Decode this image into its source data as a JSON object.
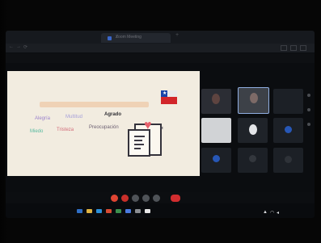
{
  "browser": {
    "tab_title": "Zoom Meeting",
    "tab_close": "×",
    "new_tab": "+",
    "address": "",
    "back_glyph": "←",
    "forward_glyph": "→",
    "reload_glyph": "⟳"
  },
  "zoom": {
    "meeting_title": "",
    "left_status": ""
  },
  "slide": {
    "heading": "",
    "flag_star": "★",
    "info_glyph": "i",
    "words": [
      {
        "name": "word-agrado",
        "text": "Agrado"
      },
      {
        "name": "word-alegria",
        "text": "Alegría"
      },
      {
        "name": "word-multitud",
        "text": "Multitud"
      },
      {
        "name": "word-miedo",
        "text": "Miedo"
      },
      {
        "name": "word-tristeza",
        "text": "Tristeza"
      },
      {
        "name": "word-preocupacion",
        "text": "Preocupación"
      },
      {
        "name": "word-extra-1",
        "text": ""
      },
      {
        "name": "word-extra-2",
        "text": ""
      },
      {
        "name": "word-extra-3",
        "text": ""
      },
      {
        "name": "word-extra-4",
        "text": ""
      },
      {
        "name": "word-extra-5",
        "text": ""
      },
      {
        "name": "word-extra-6",
        "text": ""
      }
    ]
  },
  "participants": [
    {
      "label": ""
    },
    {
      "label": ""
    },
    {
      "label": ""
    },
    {
      "label": ""
    },
    {
      "label": ""
    },
    {
      "label": ""
    },
    {
      "label": ""
    },
    {
      "label": ""
    },
    {
      "label": ""
    },
    {
      "label": ""
    },
    {
      "label": ""
    },
    {
      "label": ""
    }
  ],
  "taskbar": {
    "clock": "",
    "tray_glyph": "▲"
  },
  "colors": {
    "end_call": "#d22d2f",
    "mute_button": "#e04533",
    "avatar_blue": "#2757b6",
    "slide_background": "#f2ece0"
  },
  "icons": [
    "search-icon",
    "heart-icon",
    "document-icon",
    "info-icon",
    "mic-icon",
    "video-icon",
    "share-icon",
    "chat-icon",
    "end-call-icon",
    "wifi-icon",
    "volume-icon"
  ]
}
